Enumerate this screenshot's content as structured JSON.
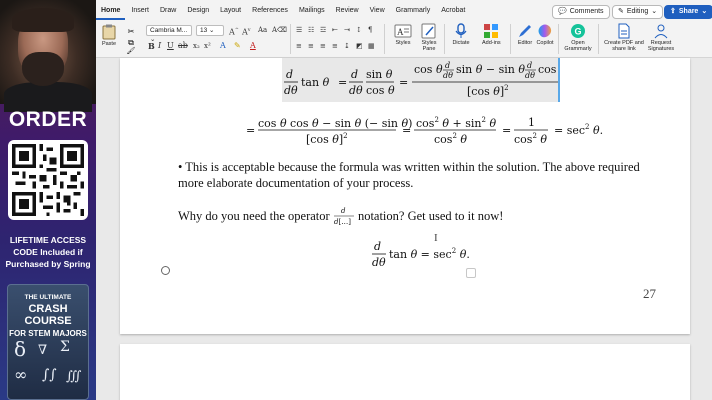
{
  "promo": {
    "order": "ORDER",
    "lines": [
      "LIFETIME ACCESS",
      "CODE Included if",
      "Purchased by Spring"
    ],
    "book": {
      "line1": "THE ULTIMATE",
      "line2a": "CRASH COURSE",
      "line2b": "FOR STEM MAJORS"
    }
  },
  "ribbon": {
    "tabs": [
      "Home",
      "Insert",
      "Draw",
      "Design",
      "Layout",
      "References",
      "Mailings",
      "Review",
      "View",
      "Grammarly",
      "Acrobat"
    ],
    "comments_label": "Comments",
    "editing_label": "Editing",
    "share_label": "Share",
    "font_name": "Cambria M...",
    "font_size": "13",
    "paste_label": "Paste",
    "styles_label": "Styles",
    "styles_pane_label": "Styles Pane",
    "dictate_label": "Dictate",
    "addins_label": "Add-ins",
    "editor_label": "Editor",
    "copilot_label": "Copilot",
    "grammarly_label": "Open Grammarly",
    "pdf_label": "Create PDF and share link",
    "signatures_label": "Request Signatures"
  },
  "document": {
    "bullet_text_1": "• This is acceptable because the formula was written within the solution. The above required",
    "bullet_text_2": "more elaborate documentation of your process.",
    "question_before": "Why do you need the operator",
    "question_after": "notation? Get used to it now!",
    "page_number": "27"
  },
  "colors": {
    "accent": "#1f5fbf",
    "selection_border": "#59a8e8"
  }
}
